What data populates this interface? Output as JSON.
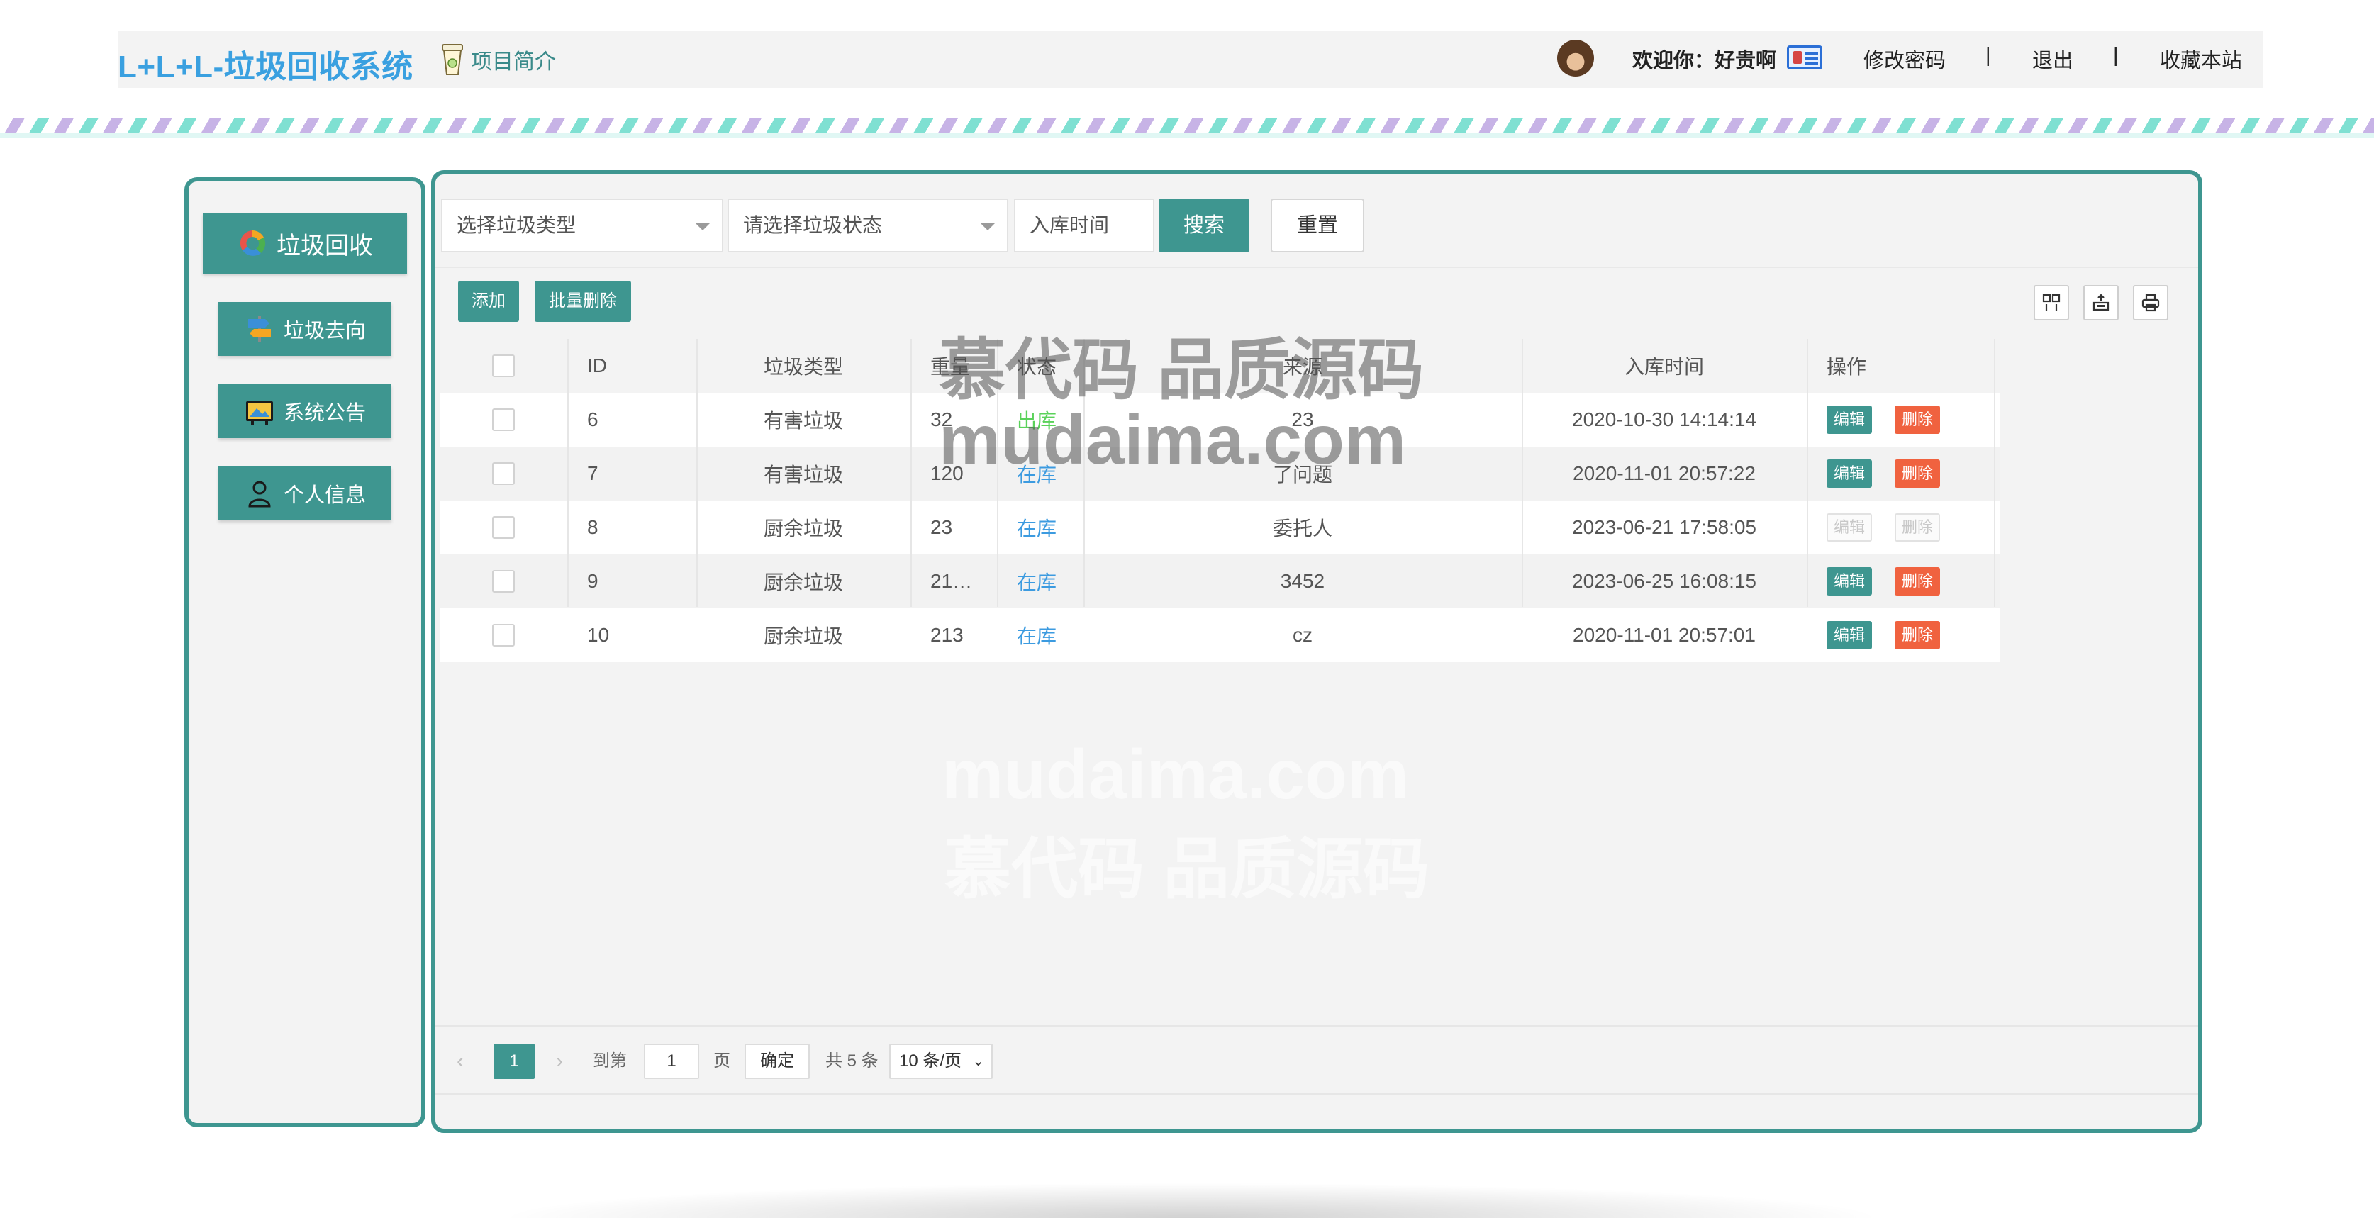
{
  "header": {
    "logo": "L+L+L-垃圾回收系统",
    "intro": "项目简介",
    "welcome": "欢迎你：好贵啊",
    "links": [
      "修改密码",
      "退出",
      "收藏本站"
    ],
    "separators": [
      "|",
      "|"
    ]
  },
  "sidebar": {
    "items": [
      {
        "label": "垃圾回收",
        "icon": "recycle-icon"
      },
      {
        "label": "垃圾去向",
        "icon": "signpost-icon"
      },
      {
        "label": "系统公告",
        "icon": "notice-board-icon"
      },
      {
        "label": "个人信息",
        "icon": "user-icon"
      }
    ]
  },
  "filters": {
    "type_placeholder": "选择垃圾类型",
    "status_placeholder": "请选择垃圾状态",
    "date_placeholder": "入库时间",
    "search": "搜索",
    "reset": "重置"
  },
  "toolbar": {
    "add": "添加",
    "batch_delete": "批量删除",
    "icons": [
      "columns-icon",
      "export-icon",
      "print-icon"
    ]
  },
  "table": {
    "headers": [
      "ID",
      "垃圾类型",
      "重量",
      "状态",
      "来源",
      "入库时间",
      "操作"
    ],
    "rows": [
      {
        "id": "6",
        "type": "有害垃圾",
        "weight": "32",
        "status": "出库",
        "status_kind": "out",
        "source": "23",
        "time": "2020-10-30 14:14:14",
        "enabled": true
      },
      {
        "id": "7",
        "type": "有害垃圾",
        "weight": "120",
        "status": "在库",
        "status_kind": "in",
        "source": "了问题",
        "time": "2020-11-01 20:57:22",
        "enabled": true
      },
      {
        "id": "8",
        "type": "厨余垃圾",
        "weight": "23",
        "status": "在库",
        "status_kind": "in",
        "source": "委托人",
        "time": "2023-06-21 17:58:05",
        "enabled": false
      },
      {
        "id": "9",
        "type": "厨余垃圾",
        "weight": "21…",
        "status": "在库",
        "status_kind": "in",
        "source": "3452",
        "time": "2023-06-25 16:08:15",
        "enabled": true
      },
      {
        "id": "10",
        "type": "厨余垃圾",
        "weight": "213",
        "status": "在库",
        "status_kind": "in",
        "source": "cz",
        "time": "2020-11-01 20:57:01",
        "enabled": true
      }
    ],
    "edit": "编辑",
    "delete": "删除"
  },
  "pagination": {
    "current": "1",
    "goto_label": "到第",
    "goto_value": "1",
    "page_label": "页",
    "confirm": "确定",
    "total": "共 5 条",
    "per_page": "10 条/页"
  },
  "watermark": {
    "line1": "慕代码 品质源码",
    "line2": "mudaima.com"
  },
  "colors": {
    "accent": "#3e9690",
    "logo": "#3aa0e0",
    "danger": "#f0623f",
    "status_out": "#5ad25a",
    "status_in": "#3c9be0"
  }
}
